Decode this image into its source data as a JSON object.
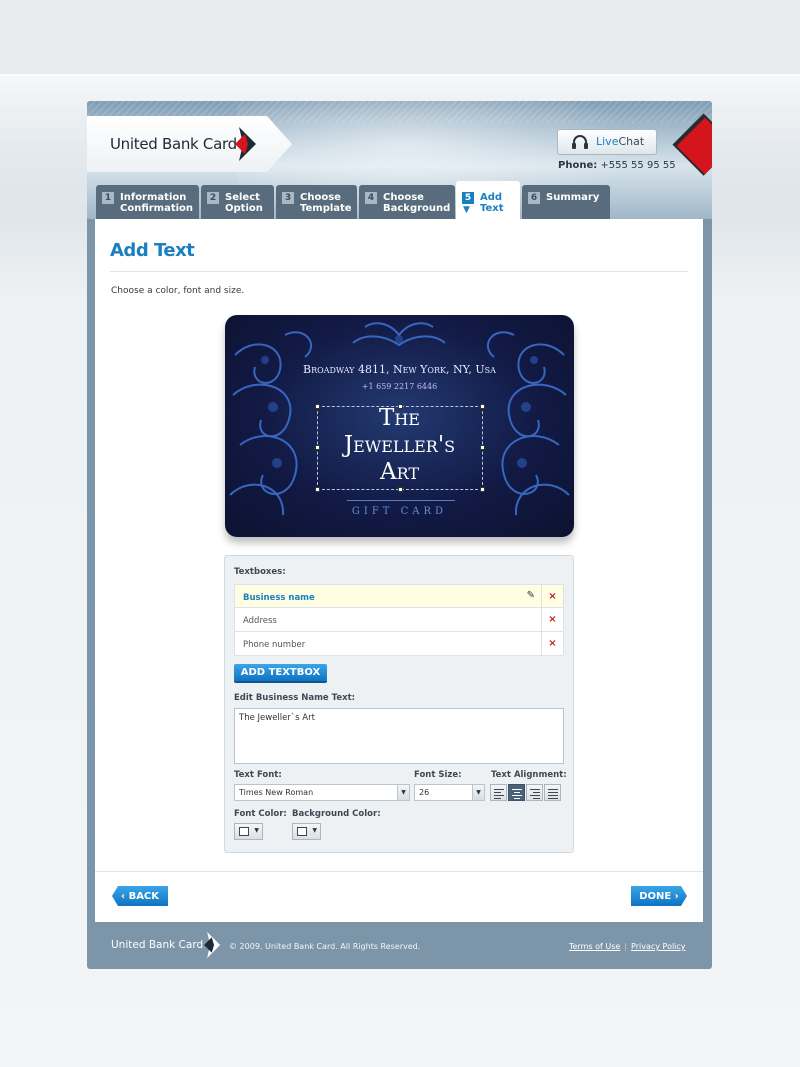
{
  "header": {
    "brand": "United Bank Card",
    "livechat_live": "Live",
    "livechat_chat": "Chat",
    "phone_label": "Phone:",
    "phone_value": "+555 55 95 55"
  },
  "tabs": [
    {
      "num": "1",
      "line1": "Information",
      "line2": "Confirmation"
    },
    {
      "num": "2",
      "line1": "Select",
      "line2": "Option"
    },
    {
      "num": "3",
      "line1": "Choose",
      "line2": "Template"
    },
    {
      "num": "4",
      "line1": "Choose",
      "line2": "Background"
    },
    {
      "num": "5",
      "line1": "Add",
      "line2": "Text",
      "active": true
    },
    {
      "num": "6",
      "line1": "Summary",
      "line2": ""
    }
  ],
  "main": {
    "title": "Add Text",
    "instruction": "Choose a color, font and size."
  },
  "card": {
    "address": "Broadway 4811, New York, NY, Usa",
    "phone": "+1 659 2217 6446",
    "title_line1": "The",
    "title_line2": "Jeweller's",
    "title_line3": "Art",
    "tag": "GIFT CARD"
  },
  "editor": {
    "textboxes_label": "Textboxes:",
    "textboxes": [
      {
        "label": "Business name",
        "selected": true
      },
      {
        "label": "Address",
        "selected": false
      },
      {
        "label": "Phone number",
        "selected": false
      }
    ],
    "delete_glyph": "×",
    "add_button": "ADD TEXTBOX",
    "edit_label": "Edit Business Name Text:",
    "edit_value": "The Jeweller`s Art",
    "font_label": "Text Font:",
    "font_value": "Times New Roman",
    "size_label": "Font Size:",
    "size_value": "26",
    "align_label": "Text Alignment:",
    "alignment_selected": "center",
    "font_color_label": "Font Color:",
    "bg_color_label": "Background Color:"
  },
  "nav": {
    "back": "‹ BACK",
    "done": "DONE ›"
  },
  "footer": {
    "brand": "United Bank Card",
    "copyright": "© 2009. United Bank Card. All Rights Reserved.",
    "terms": "Terms of Use",
    "privacy": "Privacy Policy"
  },
  "colors": {
    "accent": "#1a7fc1",
    "frame": "#7d95a9",
    "tab_bg": "#586c7e",
    "delete": "#c21b1b",
    "brand_red": "#d4151e"
  }
}
